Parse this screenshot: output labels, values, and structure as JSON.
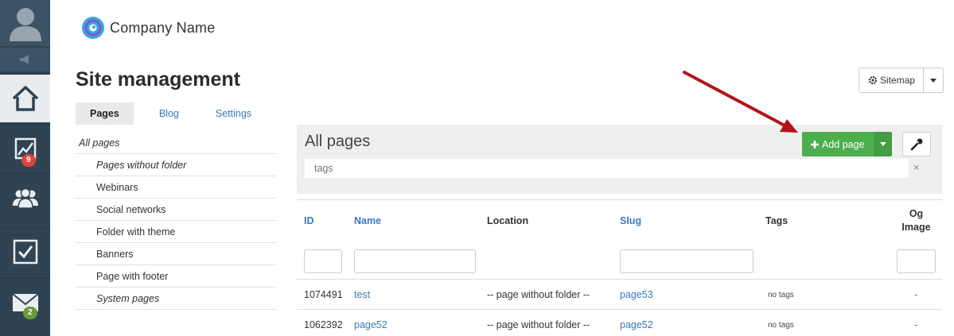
{
  "sidebar": {
    "items": [
      {
        "name": "home",
        "icon": "home-icon"
      },
      {
        "name": "stats",
        "icon": "chart-icon",
        "badge": "9",
        "badge_color": "#d9453c"
      },
      {
        "name": "users",
        "icon": "users-icon"
      },
      {
        "name": "tasks",
        "icon": "checkbox-icon"
      },
      {
        "name": "mail",
        "icon": "mail-icon",
        "badge": "2",
        "badge_color": "#6b9b37"
      }
    ]
  },
  "header": {
    "company_name": "Company Name",
    "page_title": "Site management"
  },
  "sitemap_button": {
    "label": "Sitemap",
    "icon": "gear-icon"
  },
  "tabs": [
    {
      "label": "Pages",
      "active": true
    },
    {
      "label": "Blog",
      "active": false
    },
    {
      "label": "Settings",
      "active": false
    }
  ],
  "folders": [
    "All pages",
    "Pages without folder",
    "Webinars",
    "Social networks",
    "Folder with theme",
    "Banners",
    "Page with footer",
    "System pages"
  ],
  "main": {
    "title": "All pages",
    "add_button": "Add page",
    "tags_placeholder": "tags",
    "clear_symbol": "×"
  },
  "table": {
    "headers": {
      "id": "ID",
      "name": "Name",
      "location": "Location",
      "slug": "Slug",
      "tags": "Tags",
      "og_image": "Og Image"
    },
    "rows": [
      {
        "id": "1074491",
        "name": "test",
        "location": "-- page without folder --",
        "slug": "page53",
        "tags": "no tags",
        "og_image": "-"
      },
      {
        "id": "1062392",
        "name": "page52",
        "location": "-- page without folder --",
        "slug": "page52",
        "tags": "no tags",
        "og_image": "-"
      }
    ]
  },
  "colors": {
    "rail": "#2f4353",
    "accent_green": "#4cae4c",
    "link": "#3a7ab8",
    "arrow": "#b3141a"
  }
}
